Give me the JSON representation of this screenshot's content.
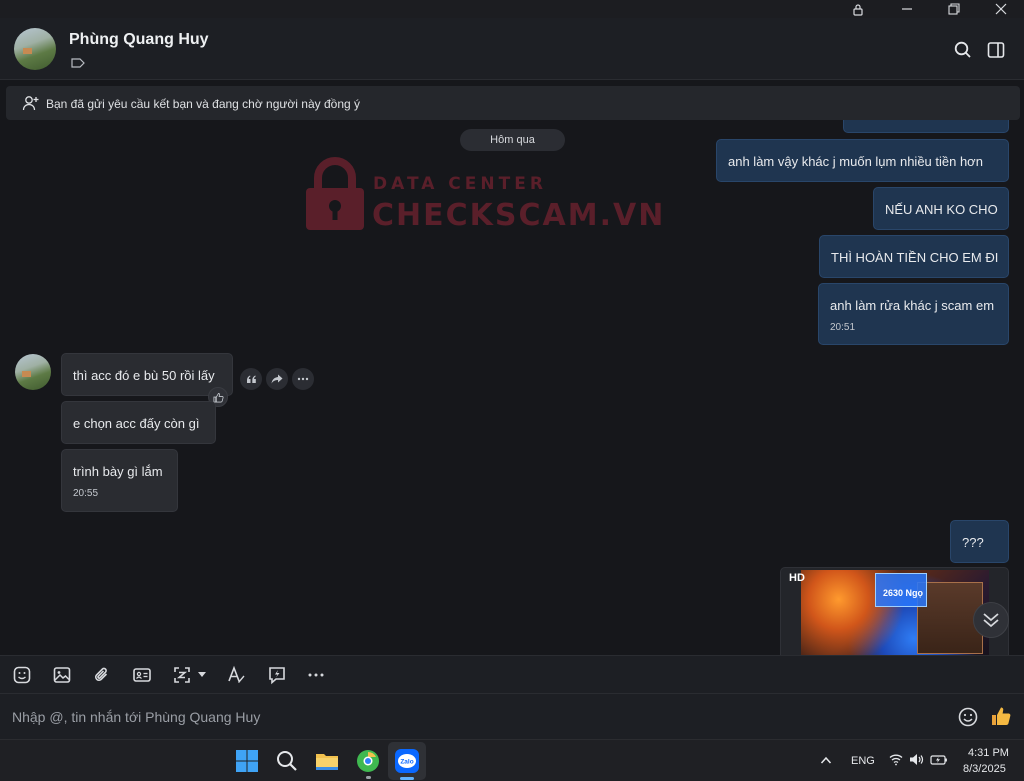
{
  "window": {
    "lock_icon": "lock-icon",
    "minimize_icon": "minimize-icon",
    "restore_icon": "restore-icon",
    "close_icon": "close-icon"
  },
  "header": {
    "contact_name": "Phùng Quang Huy",
    "search_icon": "search-icon",
    "sidebar_icon": "sidebar-toggle-icon",
    "tag_icon": "tag-icon"
  },
  "notice": {
    "text": "Bạn đã gửi yêu cầu kết bạn và đang chờ người này đồng ý"
  },
  "chat": {
    "date_divider": "Hôm qua",
    "watermark": {
      "line1": "DATA CENTER",
      "line2": "CHECKSCAM.VN"
    },
    "sent_top": [
      {
        "text": "anh làm vậy khác j muốn  lụm nhiều tiền hơn"
      },
      {
        "text": "NẾU ANH KO CHO"
      },
      {
        "text": "THÌ HOÀN TIỀN CHO EM ĐI"
      },
      {
        "text": "anh làm rửa khác j scam em",
        "time": "20:51"
      }
    ],
    "received": [
      {
        "text": "thì acc đó e bù 50 rồi lấy"
      },
      {
        "text": "e chọn acc đấy còn gì"
      },
      {
        "text": "trình bày gì lắm",
        "time": "20:55"
      }
    ],
    "sent_bottom": [
      {
        "text": "???"
      }
    ],
    "image_message": {
      "badge": "HD",
      "overlay_number": "2630 Ngọ"
    }
  },
  "toolbar": {
    "icons": [
      "sticker-icon",
      "image-icon",
      "attachment-icon",
      "contact-card-icon",
      "screenshot-icon",
      "text-format-icon",
      "quick-message-icon",
      "more-icon"
    ]
  },
  "composer": {
    "placeholder": "Nhập @, tin nhắn tới Phùng Quang Huy",
    "value": ""
  },
  "taskbar": {
    "language": "ENG",
    "time": "4:31 PM",
    "date": "8/3/2025",
    "zalo_label": "Zalo"
  },
  "colors": {
    "accent_sent": "#1f3550",
    "received_bg": "#2a2c31",
    "background": "#16171b",
    "watermark": "#5a1f2a"
  }
}
